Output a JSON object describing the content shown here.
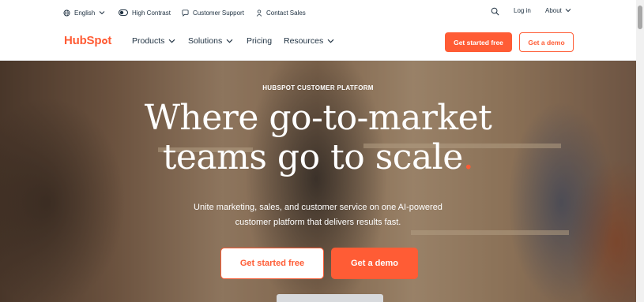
{
  "utility_bar": {
    "language": "English",
    "high_contrast": "High Contrast",
    "customer_support": "Customer Support",
    "contact_sales": "Contact Sales",
    "login": "Log in",
    "about": "About"
  },
  "nav": {
    "logo_text_a": "HubSp",
    "logo_text_b": "t",
    "items": [
      {
        "label": "Products",
        "has_dropdown": true
      },
      {
        "label": "Solutions",
        "has_dropdown": true
      },
      {
        "label": "Pricing",
        "has_dropdown": false
      },
      {
        "label": "Resources",
        "has_dropdown": true
      }
    ],
    "cta_primary": "Get started free",
    "cta_secondary": "Get a demo"
  },
  "hero": {
    "eyebrow": "HUBSPOT CUSTOMER PLATFORM",
    "headline_line1": "Where go-to-market",
    "headline_line2": "teams go to scale",
    "headline_period": ".",
    "subtext_line1": "Unite marketing, sales, and customer service on one AI-powered",
    "subtext_line2": "customer platform that delivers results fast.",
    "cta_secondary": "Get started free",
    "cta_primary": "Get a demo"
  },
  "colors": {
    "brand_orange": "#ff5c35",
    "text_dark": "#213343",
    "white": "#ffffff"
  },
  "icons": [
    "globe-icon",
    "contrast-toggle-icon",
    "support-chat-icon",
    "contact-person-icon",
    "search-icon",
    "chevron-down-icon"
  ]
}
